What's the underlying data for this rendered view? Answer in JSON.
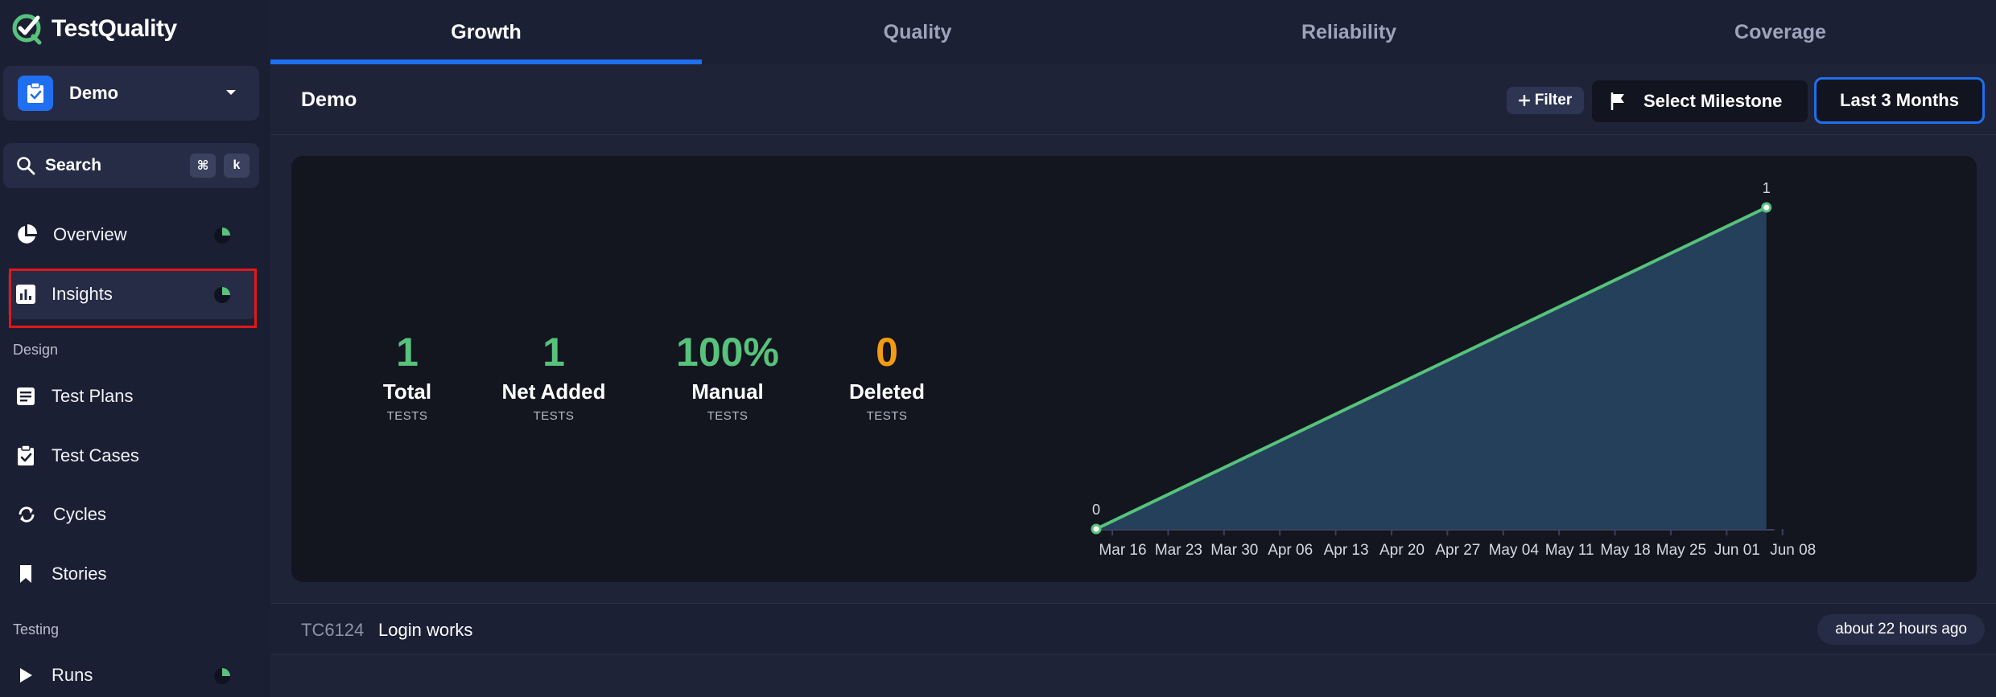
{
  "app": {
    "name": "TestQuality"
  },
  "project": {
    "name": "Demo"
  },
  "search": {
    "label": "Search",
    "kbd_cmd": "⌘",
    "kbd_key": "k"
  },
  "nav": {
    "overview": "Overview",
    "insights": "Insights",
    "design_section": "Design",
    "test_plans": "Test Plans",
    "test_cases": "Test Cases",
    "cycles": "Cycles",
    "stories": "Stories",
    "testing_section": "Testing",
    "runs": "Runs"
  },
  "tabs": [
    "Growth",
    "Quality",
    "Reliability",
    "Coverage"
  ],
  "header": {
    "title": "Demo",
    "filter_label": "Filter",
    "milestone_label": "Select Milestone",
    "range_label": "Last 3 Months"
  },
  "stats": [
    {
      "value": "1",
      "label": "Total",
      "unit": "TESTS",
      "color": "#57c27b"
    },
    {
      "value": "1",
      "label": "Net Added",
      "unit": "TESTS",
      "color": "#57c27b"
    },
    {
      "value": "100%",
      "label": "Manual",
      "unit": "TESTS",
      "color": "#57c27b"
    },
    {
      "value": "0",
      "label": "Deleted",
      "unit": "TESTS",
      "color": "#f39c12"
    }
  ],
  "chart_data": {
    "type": "area",
    "x": [
      "Mar 16",
      "Mar 23",
      "Mar 30",
      "Apr 06",
      "Apr 13",
      "Apr 20",
      "Apr 27",
      "May 04",
      "May 11",
      "May 18",
      "May 25",
      "Jun 01",
      "Jun 08"
    ],
    "points": [
      {
        "x": "Mar 16",
        "y": 0,
        "label": "0"
      },
      {
        "x": "Jun 08",
        "y": 1,
        "label": "1"
      }
    ],
    "ylim": [
      0,
      1
    ],
    "line_color": "#57c27b",
    "fill_color": "#24405a"
  },
  "recent": {
    "key": "TC6124",
    "title": "Login works",
    "time": "about 22 hours ago"
  },
  "colors": {
    "accent": "#1f6ff0",
    "success": "#57c27b",
    "warning": "#f39c12",
    "highlight": "#e01818"
  }
}
